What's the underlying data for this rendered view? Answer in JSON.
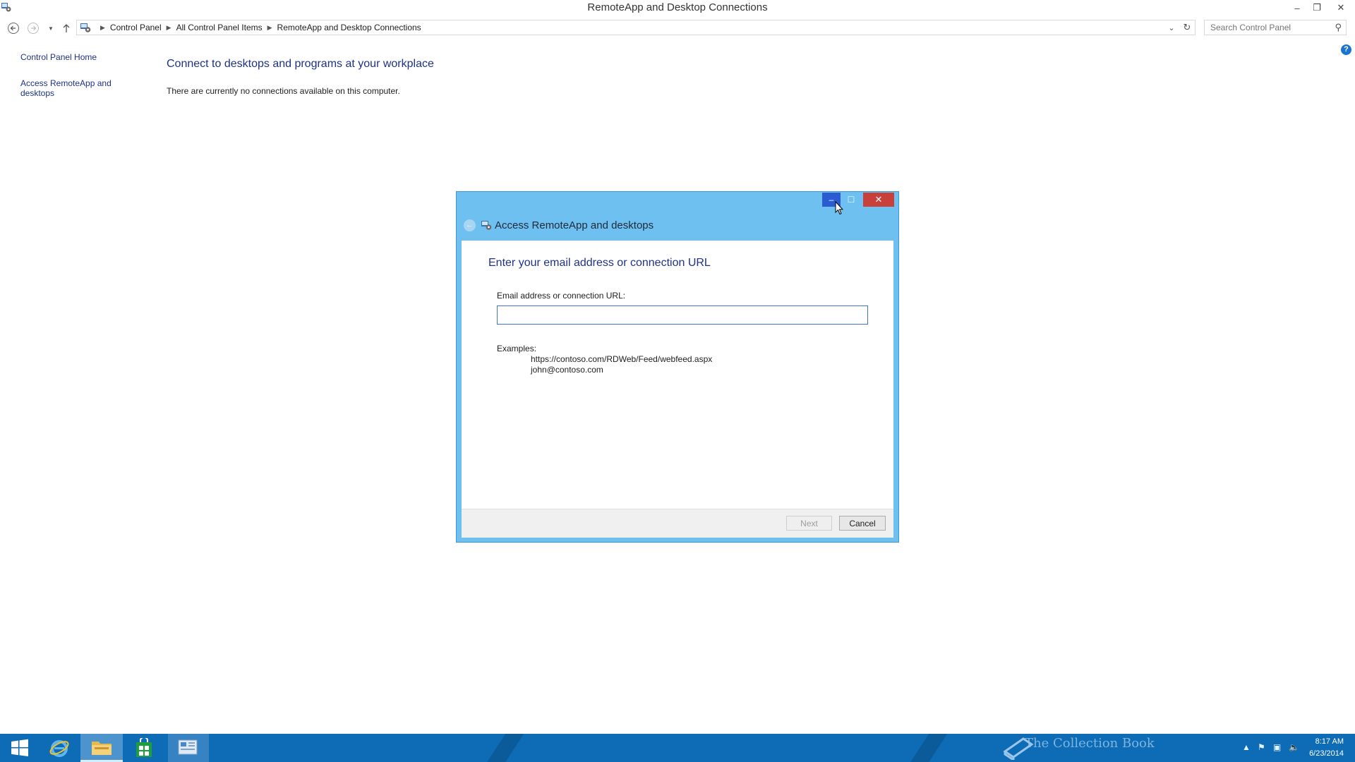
{
  "window": {
    "title": "RemoteApp and Desktop Connections"
  },
  "address_bar": {
    "breadcrumbs": [
      "Control Panel",
      "All Control Panel Items",
      "RemoteApp and Desktop Connections"
    ],
    "search_placeholder": "Search Control Panel"
  },
  "left_pane": {
    "links": [
      "Control Panel Home",
      "Access RemoteApp and desktops"
    ]
  },
  "main": {
    "heading": "Connect to desktops and programs at your workplace",
    "status": "There are currently no connections available on this computer."
  },
  "dialog": {
    "title": "Access RemoteApp and desktops",
    "instruction": "Enter your email address or connection URL",
    "field_label": "Email address or connection URL:",
    "field_value": "",
    "examples_label": "Examples:",
    "examples": [
      "https://contoso.com/RDWeb/Feed/webfeed.aspx",
      "john@contoso.com"
    ],
    "next_label": "Next",
    "cancel_label": "Cancel"
  },
  "taskbar": {
    "clock_time": "8:17 AM",
    "clock_date": "6/23/2014",
    "watermark": "The Collection Book"
  },
  "colors": {
    "accent_blue": "#1e3287",
    "dialog_frame": "#6ec0f0",
    "taskbar": "#0e6bb5",
    "close_red": "#c9403a"
  }
}
